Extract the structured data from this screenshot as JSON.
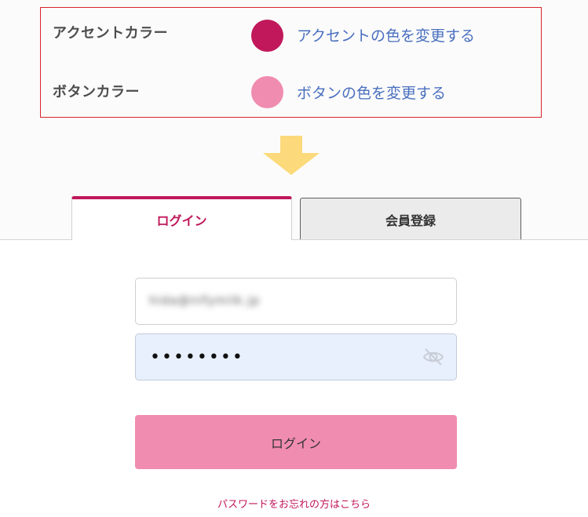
{
  "settings": {
    "accent": {
      "label": "アクセントカラー",
      "color": "#c0185a",
      "link": "アクセントの色を変更する"
    },
    "button": {
      "label": "ボタンカラー",
      "color": "#f08cb0",
      "link": "ボタンの色を変更する"
    }
  },
  "arrow_color": "#fcd97a",
  "tabs": {
    "login": "ログイン",
    "register": "会員登録"
  },
  "form": {
    "email_value": "hida@nifymilk.jp",
    "password_value": "••••••••",
    "eye_icon": "eye-slash-icon",
    "submit_label": "ログイン",
    "forgot_link": "パスワードをお忘れの方はこちら"
  }
}
